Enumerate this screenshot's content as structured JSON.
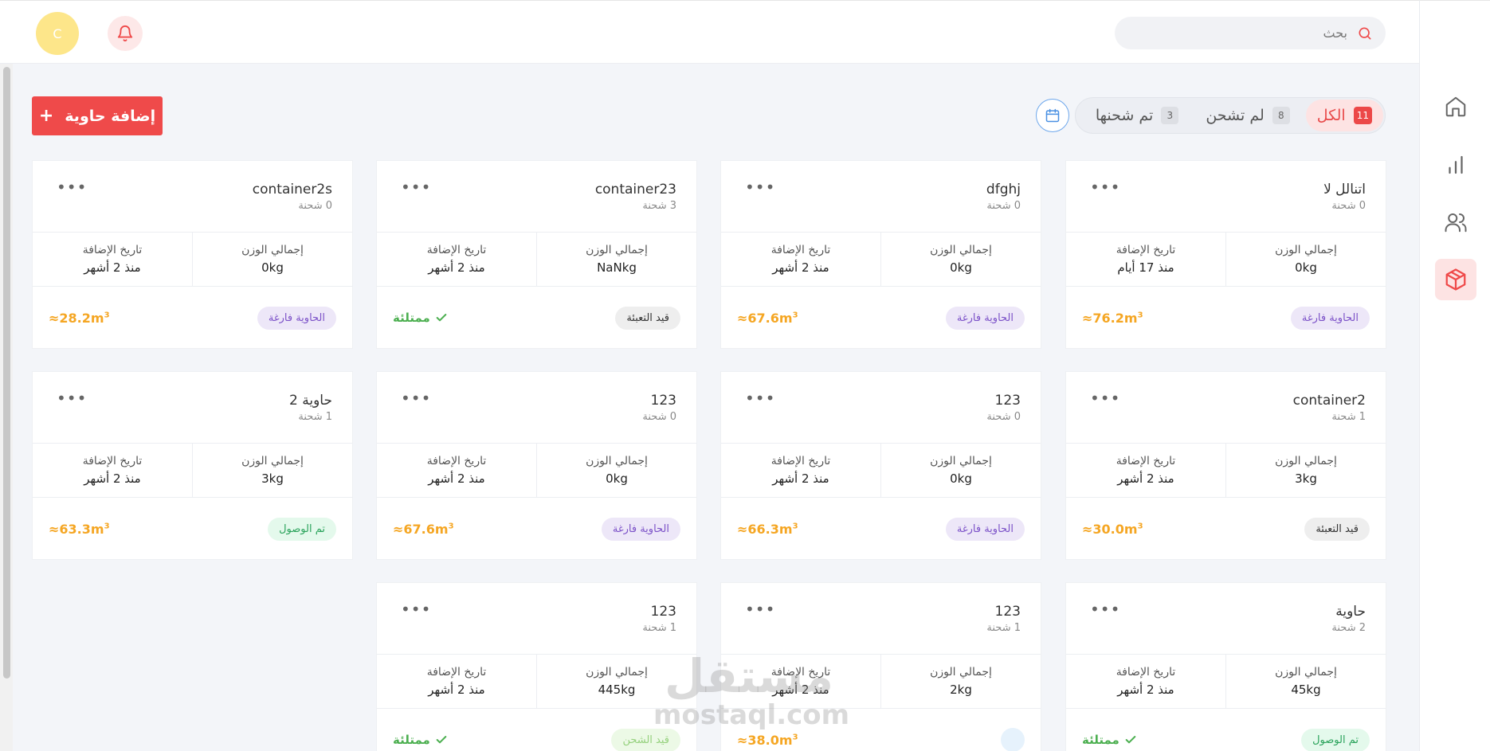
{
  "header": {
    "search_placeholder": "بحث",
    "avatar_initial": "C"
  },
  "sidebar": {
    "items": [
      {
        "name": "home",
        "icon": "home-icon",
        "active": false
      },
      {
        "name": "stats",
        "icon": "bar-chart-icon",
        "active": false
      },
      {
        "name": "users",
        "icon": "users-icon",
        "active": false
      },
      {
        "name": "containers",
        "icon": "box-icon",
        "active": true
      }
    ]
  },
  "tabs": [
    {
      "label": "الكل",
      "count": "11",
      "active": true
    },
    {
      "label": "لم تشحن",
      "count": "8",
      "active": false
    },
    {
      "label": "تم شحنها",
      "count": "3",
      "active": false
    }
  ],
  "add_button_label": "إضافة حاوية",
  "labels": {
    "total_weight": "إجمالي الوزن",
    "date_added": "تاريخ الإضافة"
  },
  "cards": [
    {
      "title": "اتنالل لا",
      "shipments": "0 شحنة",
      "weight": "0kg",
      "date": "منذ 17 أيام",
      "status": "الحاوية فارغة",
      "status_type": "empty",
      "volume": "≈76.2m",
      "full": ""
    },
    {
      "title": "dfghj",
      "shipments": "0 شحنة",
      "weight": "0kg",
      "date": "منذ 2 أشهر",
      "status": "الحاوية فارغة",
      "status_type": "empty",
      "volume": "≈67.6m",
      "full": ""
    },
    {
      "title": "container23",
      "shipments": "3 شحنة",
      "weight": "NaNkg",
      "date": "منذ 2 أشهر",
      "status": "قيد التعبئة",
      "status_type": "packing",
      "volume": "",
      "full": "ممتلئة"
    },
    {
      "title": "container2s",
      "shipments": "0 شحنة",
      "weight": "0kg",
      "date": "منذ 2 أشهر",
      "status": "الحاوية فارغة",
      "status_type": "empty",
      "volume": "≈28.2m",
      "full": ""
    },
    {
      "title": "container2",
      "shipments": "1 شحنة",
      "weight": "3kg",
      "date": "منذ 2 أشهر",
      "status": "قيد التعبئة",
      "status_type": "packing",
      "volume": "≈30.0m",
      "full": ""
    },
    {
      "title": "123",
      "shipments": "0 شحنة",
      "weight": "0kg",
      "date": "منذ 2 أشهر",
      "status": "الحاوية فارغة",
      "status_type": "empty",
      "volume": "≈66.3m",
      "full": ""
    },
    {
      "title": "123",
      "shipments": "0 شحنة",
      "weight": "0kg",
      "date": "منذ 2 أشهر",
      "status": "الحاوية فارغة",
      "status_type": "empty",
      "volume": "≈67.6m",
      "full": ""
    },
    {
      "title": "حاوية 2",
      "shipments": "1 شحنة",
      "weight": "3kg",
      "date": "منذ 2 أشهر",
      "status": "تم الوصول",
      "status_type": "arrived",
      "volume": "≈63.3m",
      "full": ""
    },
    {
      "title": "حاوية",
      "shipments": "2 شحنة",
      "weight": "45kg",
      "date": "منذ 2 أشهر",
      "status": "تم الوصول",
      "status_type": "arrived",
      "volume": "",
      "full": "ممتلئة"
    },
    {
      "title": "123",
      "shipments": "1 شحنة",
      "weight": "2kg",
      "date": "منذ 2 أشهر",
      "status": "",
      "status_type": "ghost",
      "volume": "≈38.0m",
      "full": ""
    },
    {
      "title": "123",
      "shipments": "1 شحنة",
      "weight": "445kg",
      "date": "منذ 2 أشهر",
      "status": "قيد الشحن",
      "status_type": "shipping",
      "volume": "",
      "full": "ممتلئة"
    }
  ],
  "watermark": {
    "arabic": "مستقل",
    "latin": "mostaql.com"
  },
  "colors": {
    "accent": "#ef4a4a",
    "volume": "#f5a623",
    "full": "#4caf50"
  }
}
